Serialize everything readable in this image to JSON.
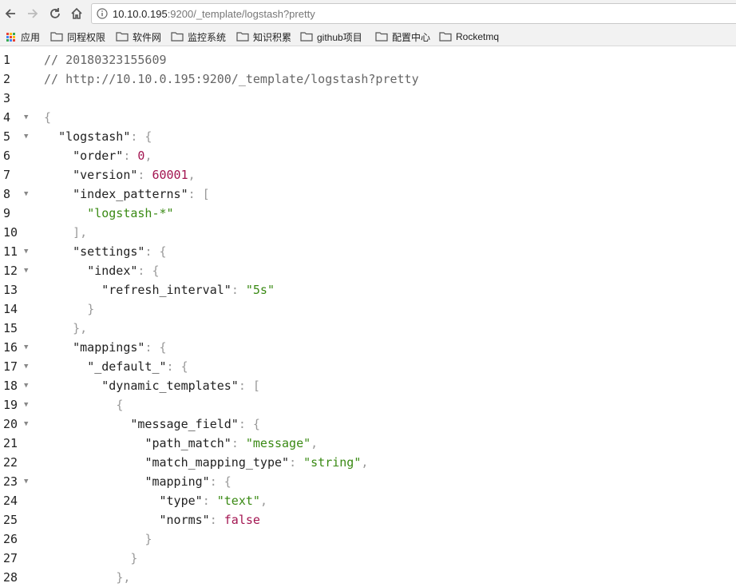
{
  "browser": {
    "url_host": "10.10.0.195",
    "url_rest": ":9200/_template/logstash?pretty"
  },
  "bookmarks": [
    {
      "label": "应用",
      "icon": "apps-grid-icon"
    },
    {
      "label": "同程权限",
      "icon": "folder-icon"
    },
    {
      "label": "软件网",
      "icon": "folder-icon"
    },
    {
      "label": "监控系统",
      "icon": "folder-icon"
    },
    {
      "label": "知识积累",
      "icon": "folder-icon"
    },
    {
      "label": "github项目",
      "icon": "folder-icon"
    },
    {
      "label": "配置中心",
      "icon": "folder-icon"
    },
    {
      "label": "Rocketmq",
      "icon": "folder-icon"
    }
  ],
  "code": {
    "fold_rows": [
      4,
      5,
      8,
      11,
      12,
      16,
      17,
      18,
      19,
      20,
      23
    ],
    "lines": [
      [
        [
          "comment",
          "// 20180323155609"
        ]
      ],
      [
        [
          "comment",
          "// http://10.10.0.195:9200/_template/logstash?pretty"
        ]
      ],
      [],
      [
        [
          "punc",
          "{"
        ]
      ],
      [
        [
          "plain",
          "  "
        ],
        [
          "key",
          "\"logstash\""
        ],
        [
          "punc",
          ": {"
        ]
      ],
      [
        [
          "plain",
          "    "
        ],
        [
          "key",
          "\"order\""
        ],
        [
          "punc",
          ": "
        ],
        [
          "num",
          "0"
        ],
        [
          "punc",
          ","
        ]
      ],
      [
        [
          "plain",
          "    "
        ],
        [
          "key",
          "\"version\""
        ],
        [
          "punc",
          ": "
        ],
        [
          "num",
          "60001"
        ],
        [
          "punc",
          ","
        ]
      ],
      [
        [
          "plain",
          "    "
        ],
        [
          "key",
          "\"index_patterns\""
        ],
        [
          "punc",
          ": ["
        ]
      ],
      [
        [
          "plain",
          "      "
        ],
        [
          "str",
          "\"logstash-*\""
        ]
      ],
      [
        [
          "plain",
          "    "
        ],
        [
          "punc",
          "],"
        ]
      ],
      [
        [
          "plain",
          "    "
        ],
        [
          "key",
          "\"settings\""
        ],
        [
          "punc",
          ": {"
        ]
      ],
      [
        [
          "plain",
          "      "
        ],
        [
          "key",
          "\"index\""
        ],
        [
          "punc",
          ": {"
        ]
      ],
      [
        [
          "plain",
          "        "
        ],
        [
          "key",
          "\"refresh_interval\""
        ],
        [
          "punc",
          ": "
        ],
        [
          "str",
          "\"5s\""
        ]
      ],
      [
        [
          "plain",
          "      "
        ],
        [
          "punc",
          "}"
        ]
      ],
      [
        [
          "plain",
          "    "
        ],
        [
          "punc",
          "},"
        ]
      ],
      [
        [
          "plain",
          "    "
        ],
        [
          "key",
          "\"mappings\""
        ],
        [
          "punc",
          ": {"
        ]
      ],
      [
        [
          "plain",
          "      "
        ],
        [
          "key",
          "\"_default_\""
        ],
        [
          "punc",
          ": {"
        ]
      ],
      [
        [
          "plain",
          "        "
        ],
        [
          "key",
          "\"dynamic_templates\""
        ],
        [
          "punc",
          ": ["
        ]
      ],
      [
        [
          "plain",
          "          "
        ],
        [
          "punc",
          "{"
        ]
      ],
      [
        [
          "plain",
          "            "
        ],
        [
          "key",
          "\"message_field\""
        ],
        [
          "punc",
          ": {"
        ]
      ],
      [
        [
          "plain",
          "              "
        ],
        [
          "key",
          "\"path_match\""
        ],
        [
          "punc",
          ": "
        ],
        [
          "str",
          "\"message\""
        ],
        [
          "punc",
          ","
        ]
      ],
      [
        [
          "plain",
          "              "
        ],
        [
          "key",
          "\"match_mapping_type\""
        ],
        [
          "punc",
          ": "
        ],
        [
          "str",
          "\"string\""
        ],
        [
          "punc",
          ","
        ]
      ],
      [
        [
          "plain",
          "              "
        ],
        [
          "key",
          "\"mapping\""
        ],
        [
          "punc",
          ": {"
        ]
      ],
      [
        [
          "plain",
          "                "
        ],
        [
          "key",
          "\"type\""
        ],
        [
          "punc",
          ": "
        ],
        [
          "str",
          "\"text\""
        ],
        [
          "punc",
          ","
        ]
      ],
      [
        [
          "plain",
          "                "
        ],
        [
          "key",
          "\"norms\""
        ],
        [
          "punc",
          ": "
        ],
        [
          "bool",
          "false"
        ]
      ],
      [
        [
          "plain",
          "              "
        ],
        [
          "punc",
          "}"
        ]
      ],
      [
        [
          "plain",
          "            "
        ],
        [
          "punc",
          "}"
        ]
      ],
      [
        [
          "plain",
          "          "
        ],
        [
          "punc",
          "},"
        ]
      ]
    ]
  }
}
